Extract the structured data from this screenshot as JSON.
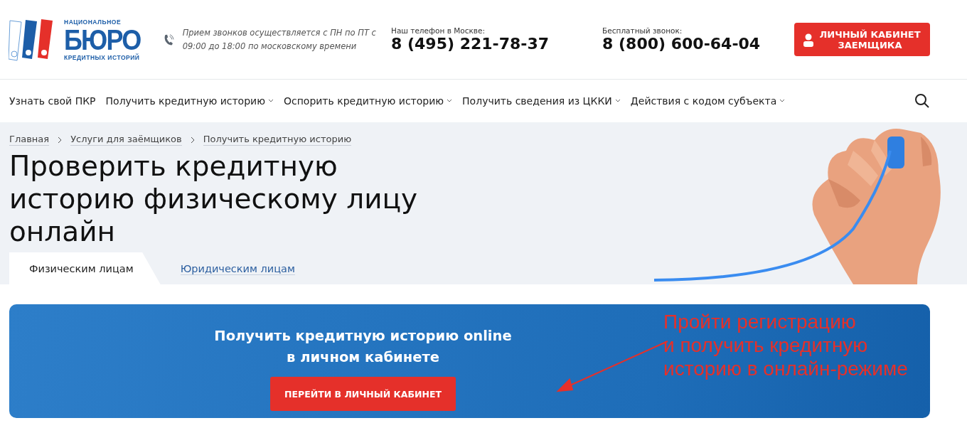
{
  "logo": {
    "top": "НАЦИОНАЛЬНОЕ",
    "main": "БЮРО",
    "bottom": "КРЕДИТНЫХ ИСТОРИЙ"
  },
  "hours": "Прием звонков осуществляется с ПН по ПТ с 09:00 до 18:00 по московскому времени",
  "phones": [
    {
      "label": "Наш телефон в Москве:",
      "number": "8 (495) 221-78-37"
    },
    {
      "label": "Бесплатный звонок:",
      "number": "8 (800) 600-64-04"
    }
  ],
  "account_button": "ЛИЧНЫЙ КАБИНЕТ ЗАЕМЩИКА",
  "nav": [
    {
      "label": "Узнать свой ПКР",
      "dropdown": false
    },
    {
      "label": "Получить кредитную историю",
      "dropdown": true
    },
    {
      "label": "Оспорить кредитную историю",
      "dropdown": true
    },
    {
      "label": "Получить сведения из ЦККИ",
      "dropdown": true
    },
    {
      "label": "Действия с кодом субъекта",
      "dropdown": true
    }
  ],
  "breadcrumbs": [
    "Главная",
    "Услуги для заёмщиков",
    "Получить кредитную историю"
  ],
  "title": "Проверить кредитную историю физическому лицу онлайн",
  "tabs": [
    {
      "label": "Физическим лицам",
      "selected": true
    },
    {
      "label": "Юридическим лицам",
      "selected": false
    }
  ],
  "banner": {
    "heading": "Получить кредитную историю online",
    "subheading": "в личном кабинете",
    "button": "ПЕРЕЙТИ В ЛИЧНЫЙ КАБИНЕТ"
  },
  "annotation": [
    "Пройти регистрацию",
    "и получить кредитную",
    "историю в онлайн-режиме"
  ]
}
